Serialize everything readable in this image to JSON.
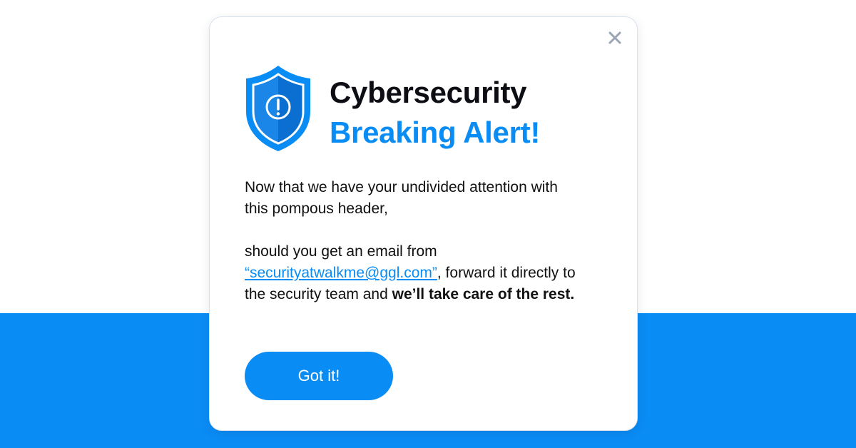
{
  "colors": {
    "accent": "#0a8cf5",
    "background_band": "#0a8cf5",
    "title_dark": "#0d0d14",
    "close_icon": "#9aa4b4"
  },
  "modal": {
    "close_icon": "close-icon",
    "shield_icon": "shield-alert-icon",
    "title_line1": "Cybersecurity",
    "title_line2": "Breaking Alert!",
    "paragraph1": "Now that we have your undivided attention with this pompous header,",
    "paragraph2_prefix": "should you get an email from ",
    "email_link": "“securityatwalkme@ggl.com”",
    "paragraph2_middle": ", forward it directly to the security team and ",
    "paragraph2_bold": "we’ll take care of the rest.",
    "button_label": "Got it!"
  }
}
